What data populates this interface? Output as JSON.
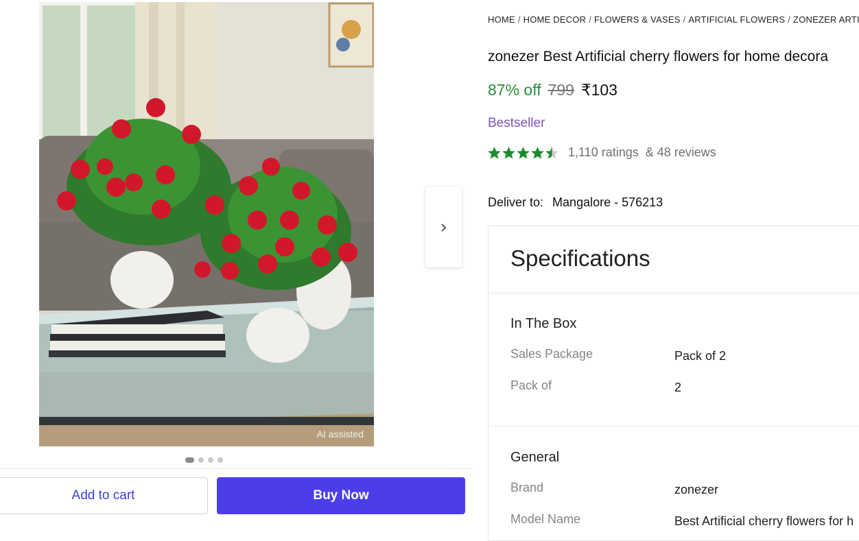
{
  "gallery": {
    "ai_badge": "AI assisted",
    "dot_count": 4,
    "active_dot": 0
  },
  "actions": {
    "add_to_cart": "Add to cart",
    "buy_now": "Buy Now"
  },
  "breadcrumb": {
    "items": [
      "HOME",
      "HOME DECOR",
      "FLOWERS & VASES",
      "ARTIFICIAL FLOWERS",
      "ZONEZER ARTIF"
    ],
    "separator": "/"
  },
  "product": {
    "title": "zonezer Best Artificial cherry flowers for home decora",
    "discount": "87% off",
    "mrp": "799",
    "price": "₹103",
    "badge": "Bestseller",
    "rating": 4.5,
    "ratings_text": "1,110 ratings",
    "reviews_text": "& 48 reviews"
  },
  "delivery": {
    "label": "Deliver to:",
    "location": "Mangalore - 576213"
  },
  "specifications": {
    "title": "Specifications",
    "sections": [
      {
        "title": "In The Box",
        "rows": [
          {
            "key": "Sales Package",
            "value": "Pack of 2"
          },
          {
            "key": "Pack of",
            "value": "2"
          }
        ]
      },
      {
        "title": "General",
        "rows": [
          {
            "key": "Brand",
            "value": "zonezer"
          },
          {
            "key": "Model Name",
            "value": "Best Artificial cherry flowers for h"
          }
        ]
      }
    ]
  },
  "colors": {
    "accent": "#4b3ee8",
    "discount": "#2a8c3c",
    "bestseller": "#7a55b8",
    "star": "#1e8a2e"
  },
  "icons": {
    "next": "chevron-right-icon",
    "star": "star-icon"
  }
}
